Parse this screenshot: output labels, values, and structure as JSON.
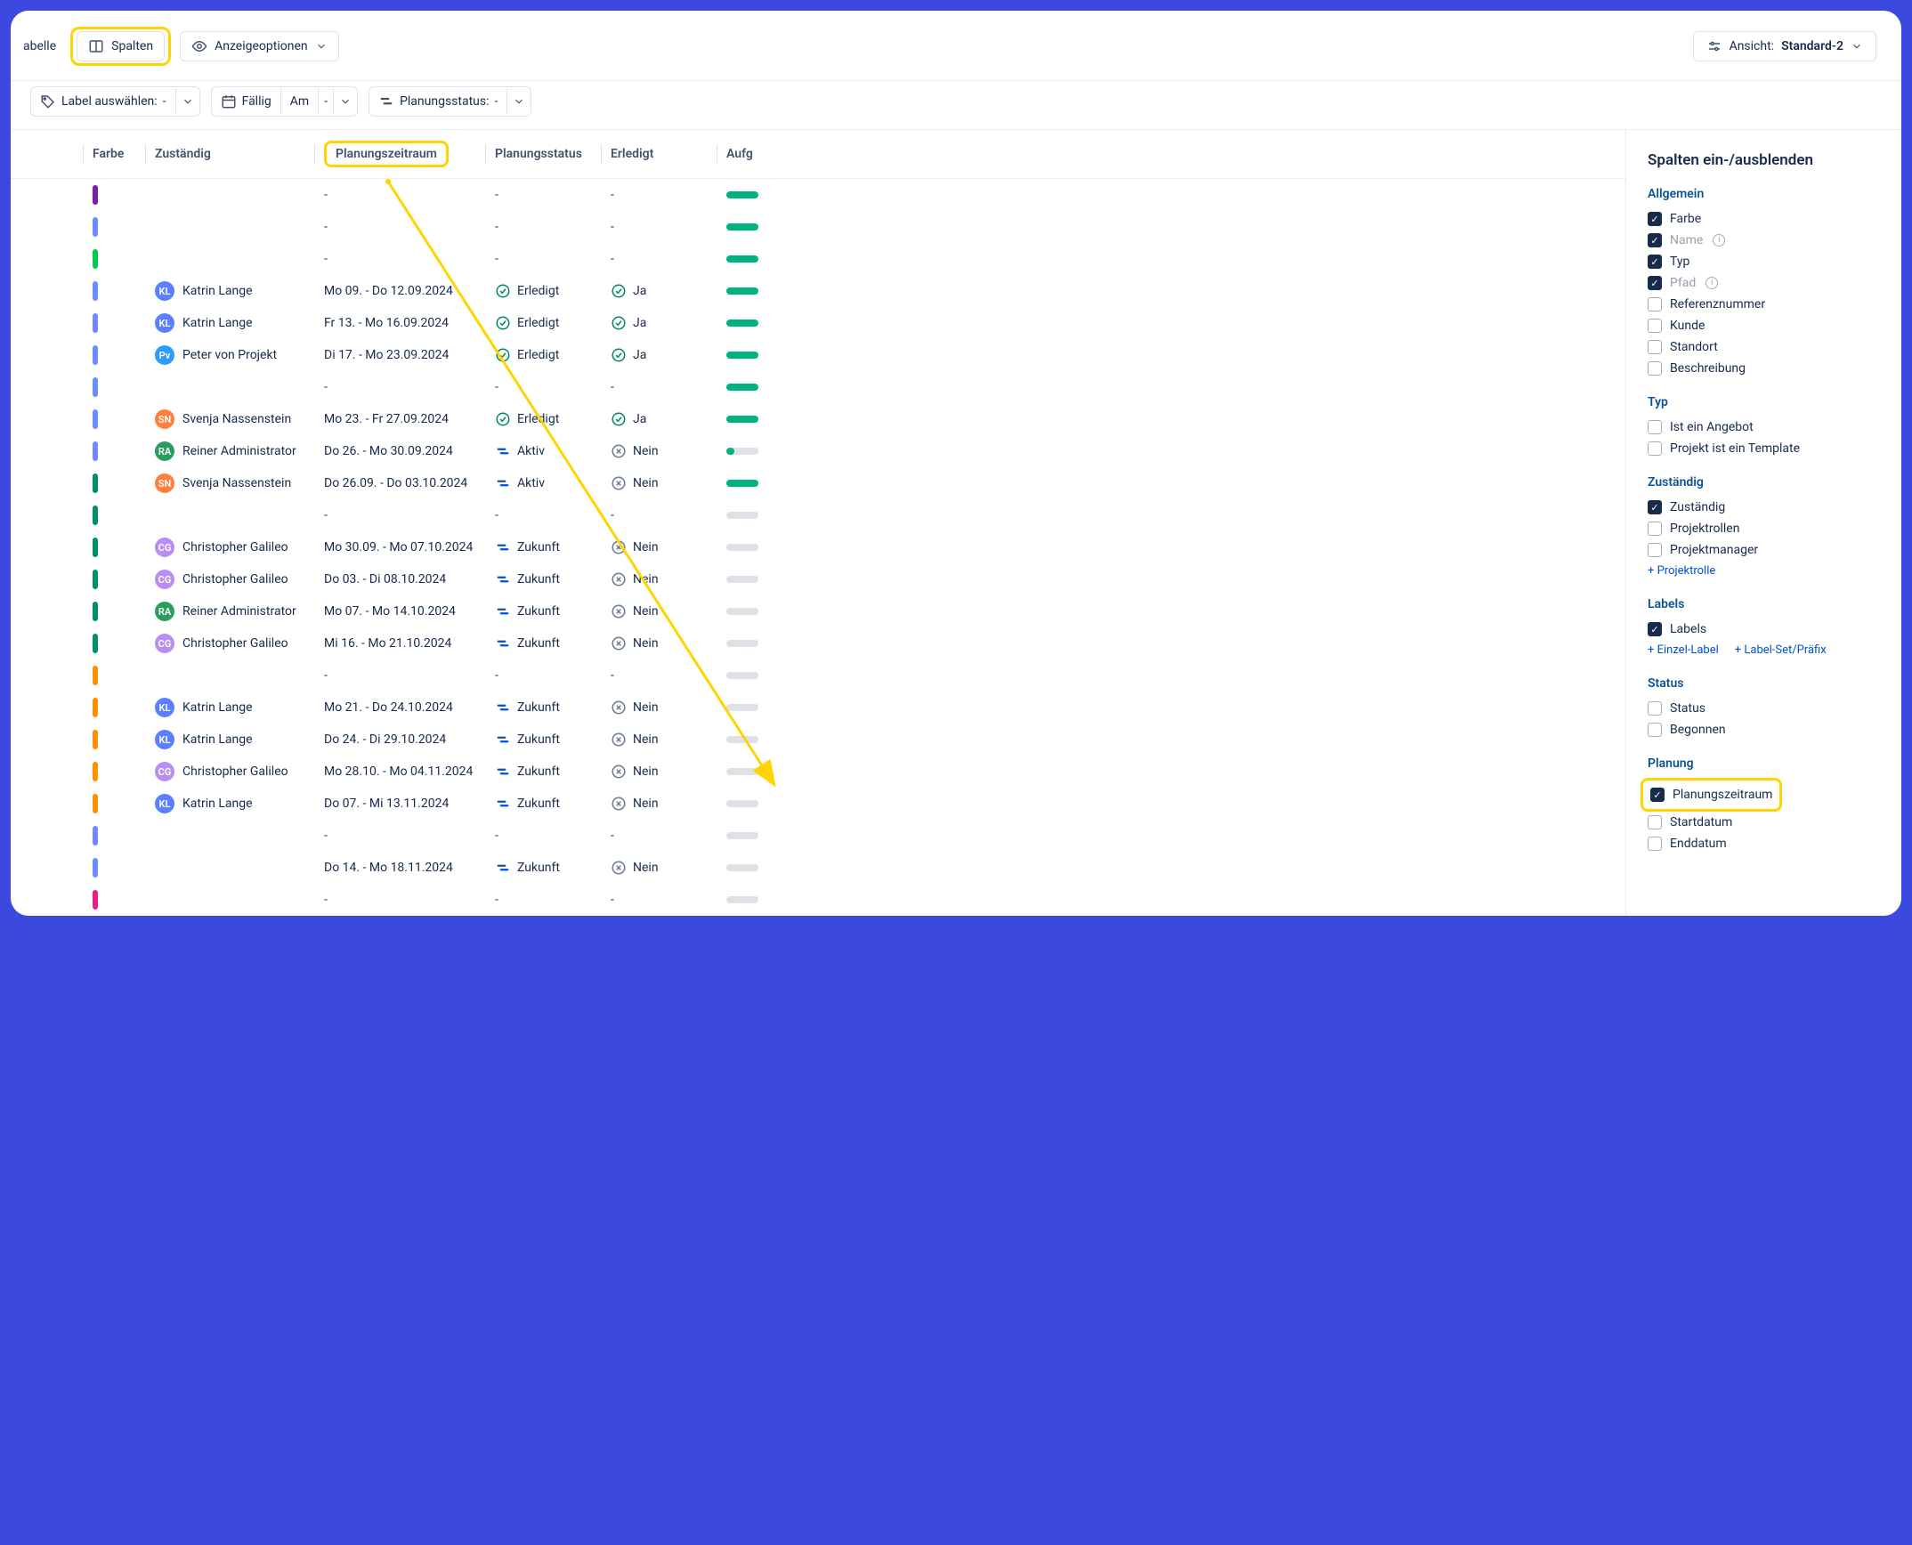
{
  "toolbar": {
    "tab_table": "abelle",
    "columns_btn": "Spalten",
    "display_options": "Anzeigeoptionen",
    "view_label": "Ansicht:",
    "view_value": "Standard-2"
  },
  "filters": {
    "label_select": "Label auswählen:",
    "label_value": "-",
    "due": "Fällig",
    "due_mode": "Am",
    "due_value": "-",
    "plan_status": "Planungsstatus:",
    "plan_value": "-"
  },
  "columns": {
    "color": "Farbe",
    "responsible": "Zuständig",
    "range": "Planungszeitraum",
    "status": "Planungsstatus",
    "done": "Erledigt",
    "aufg": "Aufg"
  },
  "status_labels": {
    "erledigt": "Erledigt",
    "aktiv": "Aktiv",
    "zukunft": "Zukunft",
    "ja": "Ja",
    "nein": "Nein"
  },
  "people": {
    "kl": "Katrin Lange",
    "pvp": "Peter von Projekt",
    "sn": "Svenja Nassenstein",
    "ra": "Reiner Administrator",
    "cg": "Christopher Galileo"
  },
  "avatar_colors": {
    "kl": "#5b7fff",
    "pvp": "#2e9cff",
    "sn": "#ff7f3f",
    "ra": "#2b9e5e",
    "cg": "#b98df2"
  },
  "rows": [
    {
      "color": "#7b1fa2",
      "person": null,
      "range": "-",
      "status": null,
      "done": null,
      "bar": "full"
    },
    {
      "color": "#6c8cff",
      "person": null,
      "range": "-",
      "status": null,
      "done": null,
      "bar": "full"
    },
    {
      "color": "#00c853",
      "person": null,
      "range": "-",
      "status": null,
      "done": null,
      "bar": "full"
    },
    {
      "color": "#6c8cff",
      "person": "kl",
      "range": "Mo 09. - Do 12.09.2024",
      "status": "erledigt",
      "done": "ja",
      "bar": "full"
    },
    {
      "color": "#6c8cff",
      "person": "kl",
      "range": "Fr 13. - Mo 16.09.2024",
      "status": "erledigt",
      "done": "ja",
      "bar": "full"
    },
    {
      "color": "#6c8cff",
      "person": "pvp",
      "range": "Di 17. - Mo 23.09.2024",
      "status": "erledigt",
      "done": "ja",
      "bar": "full"
    },
    {
      "color": "#6c8cff",
      "person": null,
      "range": "-",
      "status": null,
      "done": null,
      "bar": "full"
    },
    {
      "color": "#6c8cff",
      "person": "sn",
      "range": "Mo 23. - Fr 27.09.2024",
      "status": "erledigt",
      "done": "ja",
      "bar": "full"
    },
    {
      "color": "#6c8cff",
      "person": "ra",
      "range": "Do 26. - Mo 30.09.2024",
      "status": "aktiv",
      "done": "nein",
      "bar": "partial"
    },
    {
      "color": "#008f6b",
      "person": "sn",
      "range": "Do 26.09. - Do 03.10.2024",
      "status": "aktiv",
      "done": "nein",
      "bar": "full"
    },
    {
      "color": "#008f6b",
      "person": null,
      "range": "-",
      "status": null,
      "done": null,
      "bar": "empty"
    },
    {
      "color": "#008f6b",
      "person": "cg",
      "range": "Mo 30.09. - Mo 07.10.2024",
      "status": "zukunft",
      "done": "nein",
      "bar": "empty"
    },
    {
      "color": "#008f6b",
      "person": "cg",
      "range": "Do 03. - Di 08.10.2024",
      "status": "zukunft",
      "done": "nein",
      "bar": "empty"
    },
    {
      "color": "#008f6b",
      "person": "ra",
      "range": "Mo 07. - Mo 14.10.2024",
      "status": "zukunft",
      "done": "nein",
      "bar": "empty"
    },
    {
      "color": "#008f6b",
      "person": "cg",
      "range": "Mi 16. - Mo 21.10.2024",
      "status": "zukunft",
      "done": "nein",
      "bar": "empty"
    },
    {
      "color": "#ff9100",
      "person": null,
      "range": "-",
      "status": null,
      "done": null,
      "bar": "empty"
    },
    {
      "color": "#ff9100",
      "person": "kl",
      "range": "Mo 21. - Do 24.10.2024",
      "status": "zukunft",
      "done": "nein",
      "bar": "empty"
    },
    {
      "color": "#ff9100",
      "person": "kl",
      "range": "Do 24. - Di 29.10.2024",
      "status": "zukunft",
      "done": "nein",
      "bar": "empty"
    },
    {
      "color": "#ff9100",
      "person": "cg",
      "range": "Mo 28.10. - Mo 04.11.2024",
      "status": "zukunft",
      "done": "nein",
      "bar": "empty"
    },
    {
      "color": "#ff9100",
      "person": "kl",
      "range": "Do 07. - Mi 13.11.2024",
      "status": "zukunft",
      "done": "nein",
      "bar": "empty"
    },
    {
      "color": "#6c8cff",
      "person": null,
      "range": "-",
      "status": null,
      "done": null,
      "bar": "empty"
    },
    {
      "color": "#6c8cff",
      "person": null,
      "range": "Do 14. - Mo 18.11.2024",
      "status": "zukunft",
      "done": "nein",
      "bar": "empty"
    },
    {
      "color": "#e91e8c",
      "person": null,
      "range": "-",
      "status": null,
      "done": null,
      "bar": "empty"
    }
  ],
  "sidebar": {
    "title": "Spalten ein-/ausblenden",
    "groups": [
      {
        "title": "Allgemein",
        "items": [
          {
            "label": "Farbe",
            "checked": true
          },
          {
            "label": "Name",
            "checked": true,
            "info": true,
            "disabled": true
          },
          {
            "label": "Typ",
            "checked": true
          },
          {
            "label": "Pfad",
            "checked": true,
            "info": true,
            "disabled": true
          },
          {
            "label": "Referenznummer",
            "checked": false
          },
          {
            "label": "Kunde",
            "checked": false
          },
          {
            "label": "Standort",
            "checked": false
          },
          {
            "label": "Beschreibung",
            "checked": false
          }
        ]
      },
      {
        "title": "Typ",
        "items": [
          {
            "label": "Ist ein Angebot",
            "checked": false
          },
          {
            "label": "Projekt ist ein Template",
            "checked": false
          }
        ]
      },
      {
        "title": "Zuständig",
        "items": [
          {
            "label": "Zuständig",
            "checked": true
          },
          {
            "label": "Projektrollen",
            "checked": false
          },
          {
            "label": "Projektmanager",
            "checked": false
          }
        ],
        "links": [
          "+ Projektrolle"
        ]
      },
      {
        "title": "Labels",
        "items": [
          {
            "label": "Labels",
            "checked": true
          }
        ],
        "links": [
          "+ Einzel-Label",
          "+ Label-Set/Präfix"
        ]
      },
      {
        "title": "Status",
        "items": [
          {
            "label": "Status",
            "checked": false
          },
          {
            "label": "Begonnen",
            "checked": false
          }
        ]
      },
      {
        "title": "Planung",
        "items": [
          {
            "label": "Planungszeitraum",
            "checked": true,
            "highlight": true
          },
          {
            "label": "Startdatum",
            "checked": false
          },
          {
            "label": "Enddatum",
            "checked": false
          }
        ]
      }
    ]
  }
}
